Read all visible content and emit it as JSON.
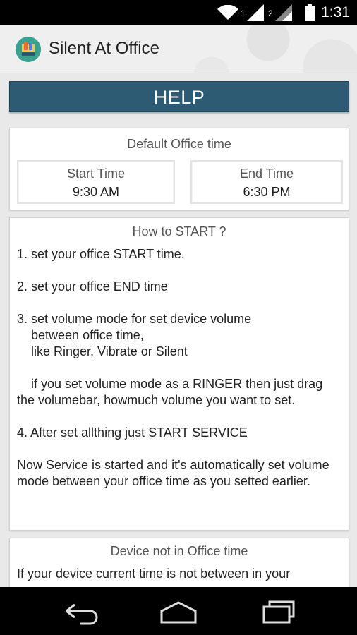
{
  "status_bar": {
    "time": "1:31",
    "sim1_label": "1",
    "sim2_label": "2",
    "icons": [
      "wifi-icon",
      "signal-sim1-icon",
      "signal-sim2-icon",
      "battery-icon"
    ]
  },
  "app_bar": {
    "title": "Silent At Office",
    "logo_icon": "app-logo-icon"
  },
  "help": {
    "label": "HELP",
    "color": "#2d5b73"
  },
  "office_time": {
    "title": "Default Office time",
    "start_label": "Start Time",
    "start_value": "9:30 AM",
    "end_label": "End Time",
    "end_value": "6:30 PM"
  },
  "how_to_start": {
    "title": "How to START ?",
    "step1": "1. set your office START time.",
    "step2": "2. set your office END time",
    "step3": "3. set volume mode for set device volume\n    between office time,\n    like Ringer, Vibrate or Silent",
    "note": "    if you set volume mode as a RINGER then just drag the volumebar, howmuch volume you want to set.",
    "step4": "4. After set allthing just START SERVICE",
    "summary": "Now Service is started and it's automatically set volume mode between your office time as you setted earlier."
  },
  "device_section": {
    "title": "Device not in Office time",
    "text": "If your device current time is not between in your"
  },
  "nav_bar": {
    "icons": [
      "back-icon",
      "home-icon",
      "recents-icon"
    ]
  }
}
